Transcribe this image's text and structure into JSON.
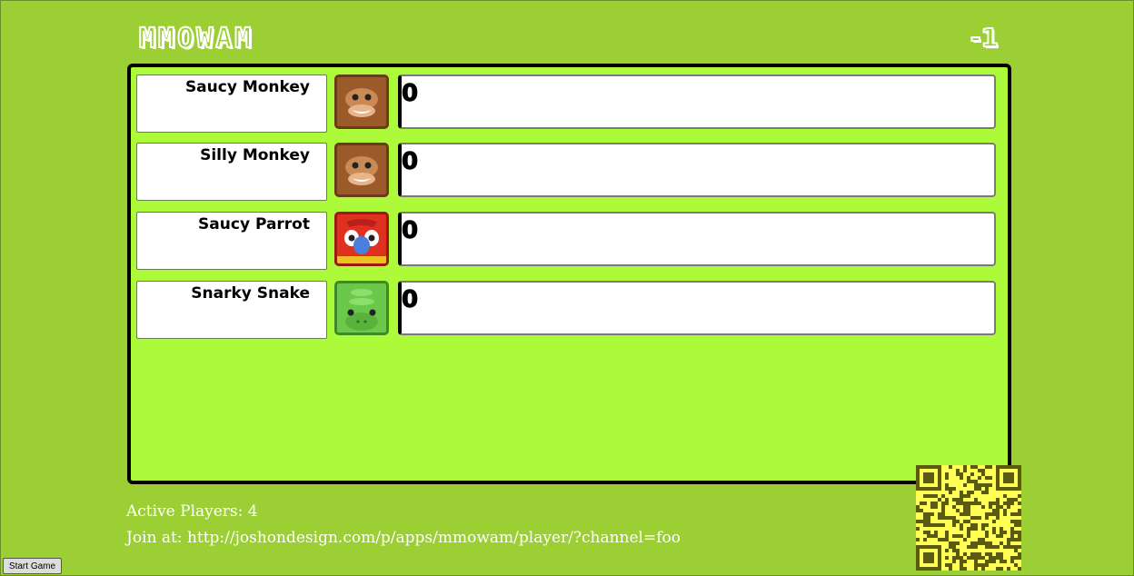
{
  "header": {
    "logo": "MMOWAM",
    "round": "-1"
  },
  "players": [
    {
      "name": "Saucy Monkey",
      "avatar": "monkey-avatar",
      "score": "0"
    },
    {
      "name": "Silly Monkey",
      "avatar": "monkey-avatar",
      "score": "0"
    },
    {
      "name": "Saucy Parrot",
      "avatar": "parrot-avatar",
      "score": "0"
    },
    {
      "name": "Snarky Snake",
      "avatar": "snake-avatar",
      "score": "0"
    }
  ],
  "footer": {
    "active_players": "Active Players: 4",
    "join": "Join at: http://joshondesign.com/p/apps/mmowam/player/?channel=foo"
  },
  "controls": {
    "start_label": "Start Game"
  },
  "colors": {
    "background": "#9ccf33",
    "board": "#adfa3b",
    "qr": "#ffff55"
  }
}
